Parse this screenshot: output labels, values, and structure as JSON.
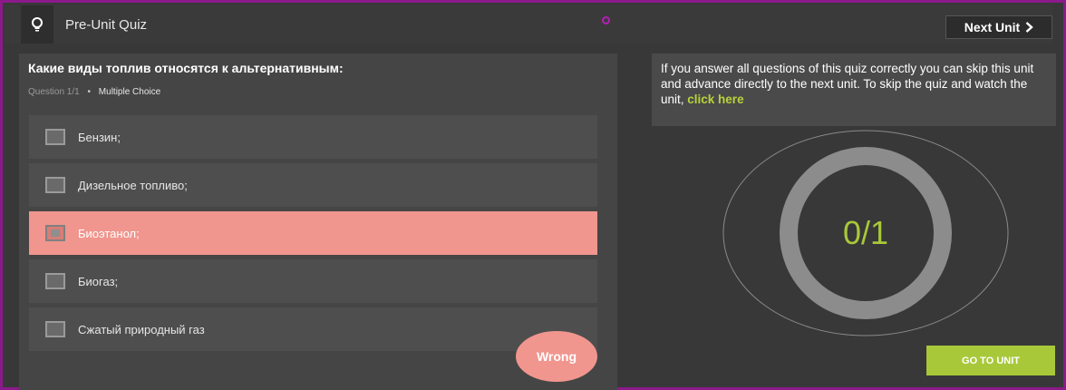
{
  "header": {
    "title": "Pre-Unit Quiz",
    "logo_icon": "lightbulb-icon",
    "next_unit_label": "Next Unit",
    "next_unit_icon": "chevron-right-icon"
  },
  "question": {
    "text": "Какие виды топлив относятся к альтернативным:",
    "number": "Question 1/1",
    "separator": "•",
    "type": "Multiple Choice"
  },
  "options": [
    {
      "label": "Бензин;",
      "state": "unselected"
    },
    {
      "label": "Дизельное топливо;",
      "state": "unselected"
    },
    {
      "label": "Биоэтанол;",
      "state": "selected-wrong"
    },
    {
      "label": "Биогаз;",
      "state": "unselected"
    },
    {
      "label": "Сжатый природный газ",
      "state": "unselected"
    }
  ],
  "feedback": {
    "label": "Wrong",
    "color": "#f0968e"
  },
  "info": {
    "text": "If you answer all questions of this quiz correctly you can skip this unit and advance directly to the next unit. To skip the quiz and watch the unit, ",
    "link": "click here"
  },
  "score": {
    "display": "0/1",
    "correct": 0,
    "total": 1
  },
  "go_to_unit_label": "GO TO UNIT",
  "colors": {
    "accent": "#a8c83a",
    "wrong": "#f0968e",
    "frame": "#8a1a8a",
    "background": "#383838"
  }
}
